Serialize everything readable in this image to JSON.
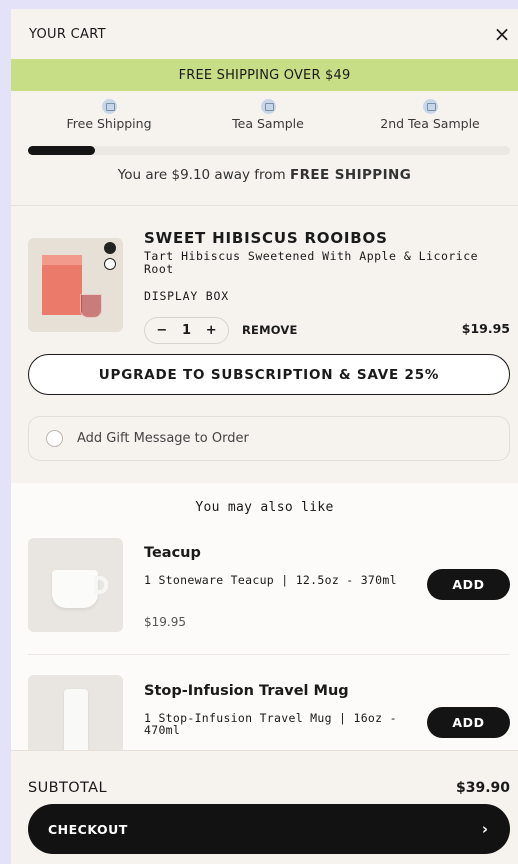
{
  "header": {
    "title": "YOUR CART",
    "close_glyph": "×"
  },
  "banner": {
    "text": "FREE SHIPPING OVER $49"
  },
  "milestones": [
    {
      "icon": "truck-icon",
      "label": "Free Shipping"
    },
    {
      "icon": "gift-bag-icon",
      "label": "Tea Sample"
    },
    {
      "icon": "gift-bag-icon",
      "label": "2nd Tea Sample"
    }
  ],
  "progress": {
    "fraction": 0.14
  },
  "away": {
    "prefix": "You are $9.10 away from ",
    "emphasis": "FREE SHIPPING"
  },
  "cart_item": {
    "title": "SWEET HIBISCUS ROOIBOS",
    "description": "Tart Hibiscus Sweetened With Apple & Licorice Root",
    "variant": "DISPLAY BOX",
    "qty_minus": "−",
    "quantity": "1",
    "qty_plus": "+",
    "remove_label": "REMOVE",
    "price": "$19.95"
  },
  "upgrade": {
    "label": "UPGRADE TO SUBSCRIPTION & SAVE 25%"
  },
  "gift": {
    "label": "Add Gift Message to Order"
  },
  "recommendations": {
    "title": "You may also like",
    "items": [
      {
        "name": "Teacup",
        "description": "1 Stoneware Teacup | 12.5oz - 370ml",
        "price": "$19.95",
        "add_label": "ADD"
      },
      {
        "name": "Stop-Infusion Travel Mug",
        "description": "1 Stop-Infusion Travel Mug | 16oz - 470ml",
        "add_label": "ADD"
      }
    ]
  },
  "footer": {
    "subtotal_label": "SUBTOTAL",
    "subtotal_value": "$39.90",
    "checkout_label": "CHECKOUT",
    "checkout_chevron": "›"
  },
  "colors": {
    "banner": "#c8de86",
    "primary": "#121212",
    "background": "#f6f3ef",
    "page": "#e4e2f8"
  }
}
